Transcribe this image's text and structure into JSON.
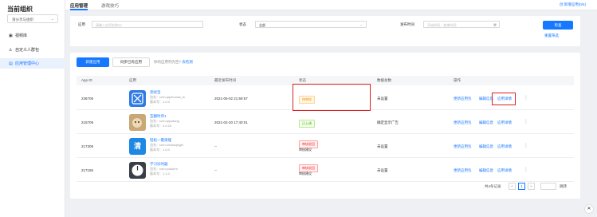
{
  "sidebar": {
    "brand": "当前组织",
    "org_select": "请分享与组织",
    "items": [
      {
        "icon": "▣",
        "label": "视频库"
      },
      {
        "icon": "♙",
        "label": "自定义人群包"
      },
      {
        "icon": "▤",
        "label": "应用管理中心"
      }
    ]
  },
  "header": {
    "tabs": [
      {
        "label": "应用管理"
      },
      {
        "label": "游戏技巧"
      }
    ],
    "new_app_link": "创 新增应用(0/4)"
  },
  "filter": {
    "app_label": "应用",
    "app_placeholder": "请输入应用名称/ID",
    "status_label": "状态",
    "status_value": "全部",
    "time_label": "发布时间",
    "time_placeholder": "开始时间 ~ 结束时间",
    "search_button": "检查",
    "reset_link": "重置筛选"
  },
  "toolbar": {
    "create_button": "新建应用",
    "sync_button": "同步已有应用",
    "hint": "你的应用列为空? ",
    "hint_link": "去检测"
  },
  "table": {
    "headers": [
      "App ID",
      "应用",
      "最近发布时间",
      "状态",
      "数据总数",
      "操作"
    ],
    "rows": [
      {
        "id": "236705",
        "name": "测试宝",
        "pkg": "包名：com.qqchuxiao_lk",
        "ver": "版本号：1.0.0",
        "time": "2021-05-02 21:59:57",
        "status": "待审核",
        "status_type": "pending",
        "status_sub": "",
        "data": "未设置",
        "ops": [
          "更新应用包",
          "编辑信息",
          "应用详情"
        ]
      },
      {
        "id": "215709",
        "name": "互翻时评1",
        "pkg": "包名：com.qiyudang",
        "ver": "版本号：4.0.24",
        "time": "2021-02-20 17:40:01",
        "status": "已上线",
        "status_type": "online",
        "status_sub": "",
        "data": "确定显示广告",
        "ops": [
          "更新应用包",
          "编辑信息",
          "应用详情"
        ]
      },
      {
        "id": "217309",
        "name": "轻松一键清理",
        "pkg": "包名：com.zhchaqinglii",
        "ver": "版本号：1.0.0",
        "time": "--",
        "status": "审核驳回",
        "status_type": "rejected",
        "status_sub": "审核建议",
        "data": "未设置",
        "ops": [
          "更新应用包",
          "编辑信息",
          "应用详情"
        ]
      },
      {
        "id": "217165",
        "name": "学习乐时器",
        "pkg": "包名：com.yuduirm",
        "ver": "版本号：1.1.0",
        "time": "--",
        "status": "审核驳回",
        "status_type": "rejected",
        "status_sub": "审核建议",
        "data": "未设置",
        "ops": [
          "更新应用包",
          "编辑信息",
          "应用详情"
        ]
      }
    ]
  },
  "pagination": {
    "total": "共4条记录",
    "prev": "<",
    "current": "1",
    "next": ">",
    "goto": "跳转"
  },
  "colors": {
    "accent": "#1677ff",
    "highlight": "#e02020"
  }
}
